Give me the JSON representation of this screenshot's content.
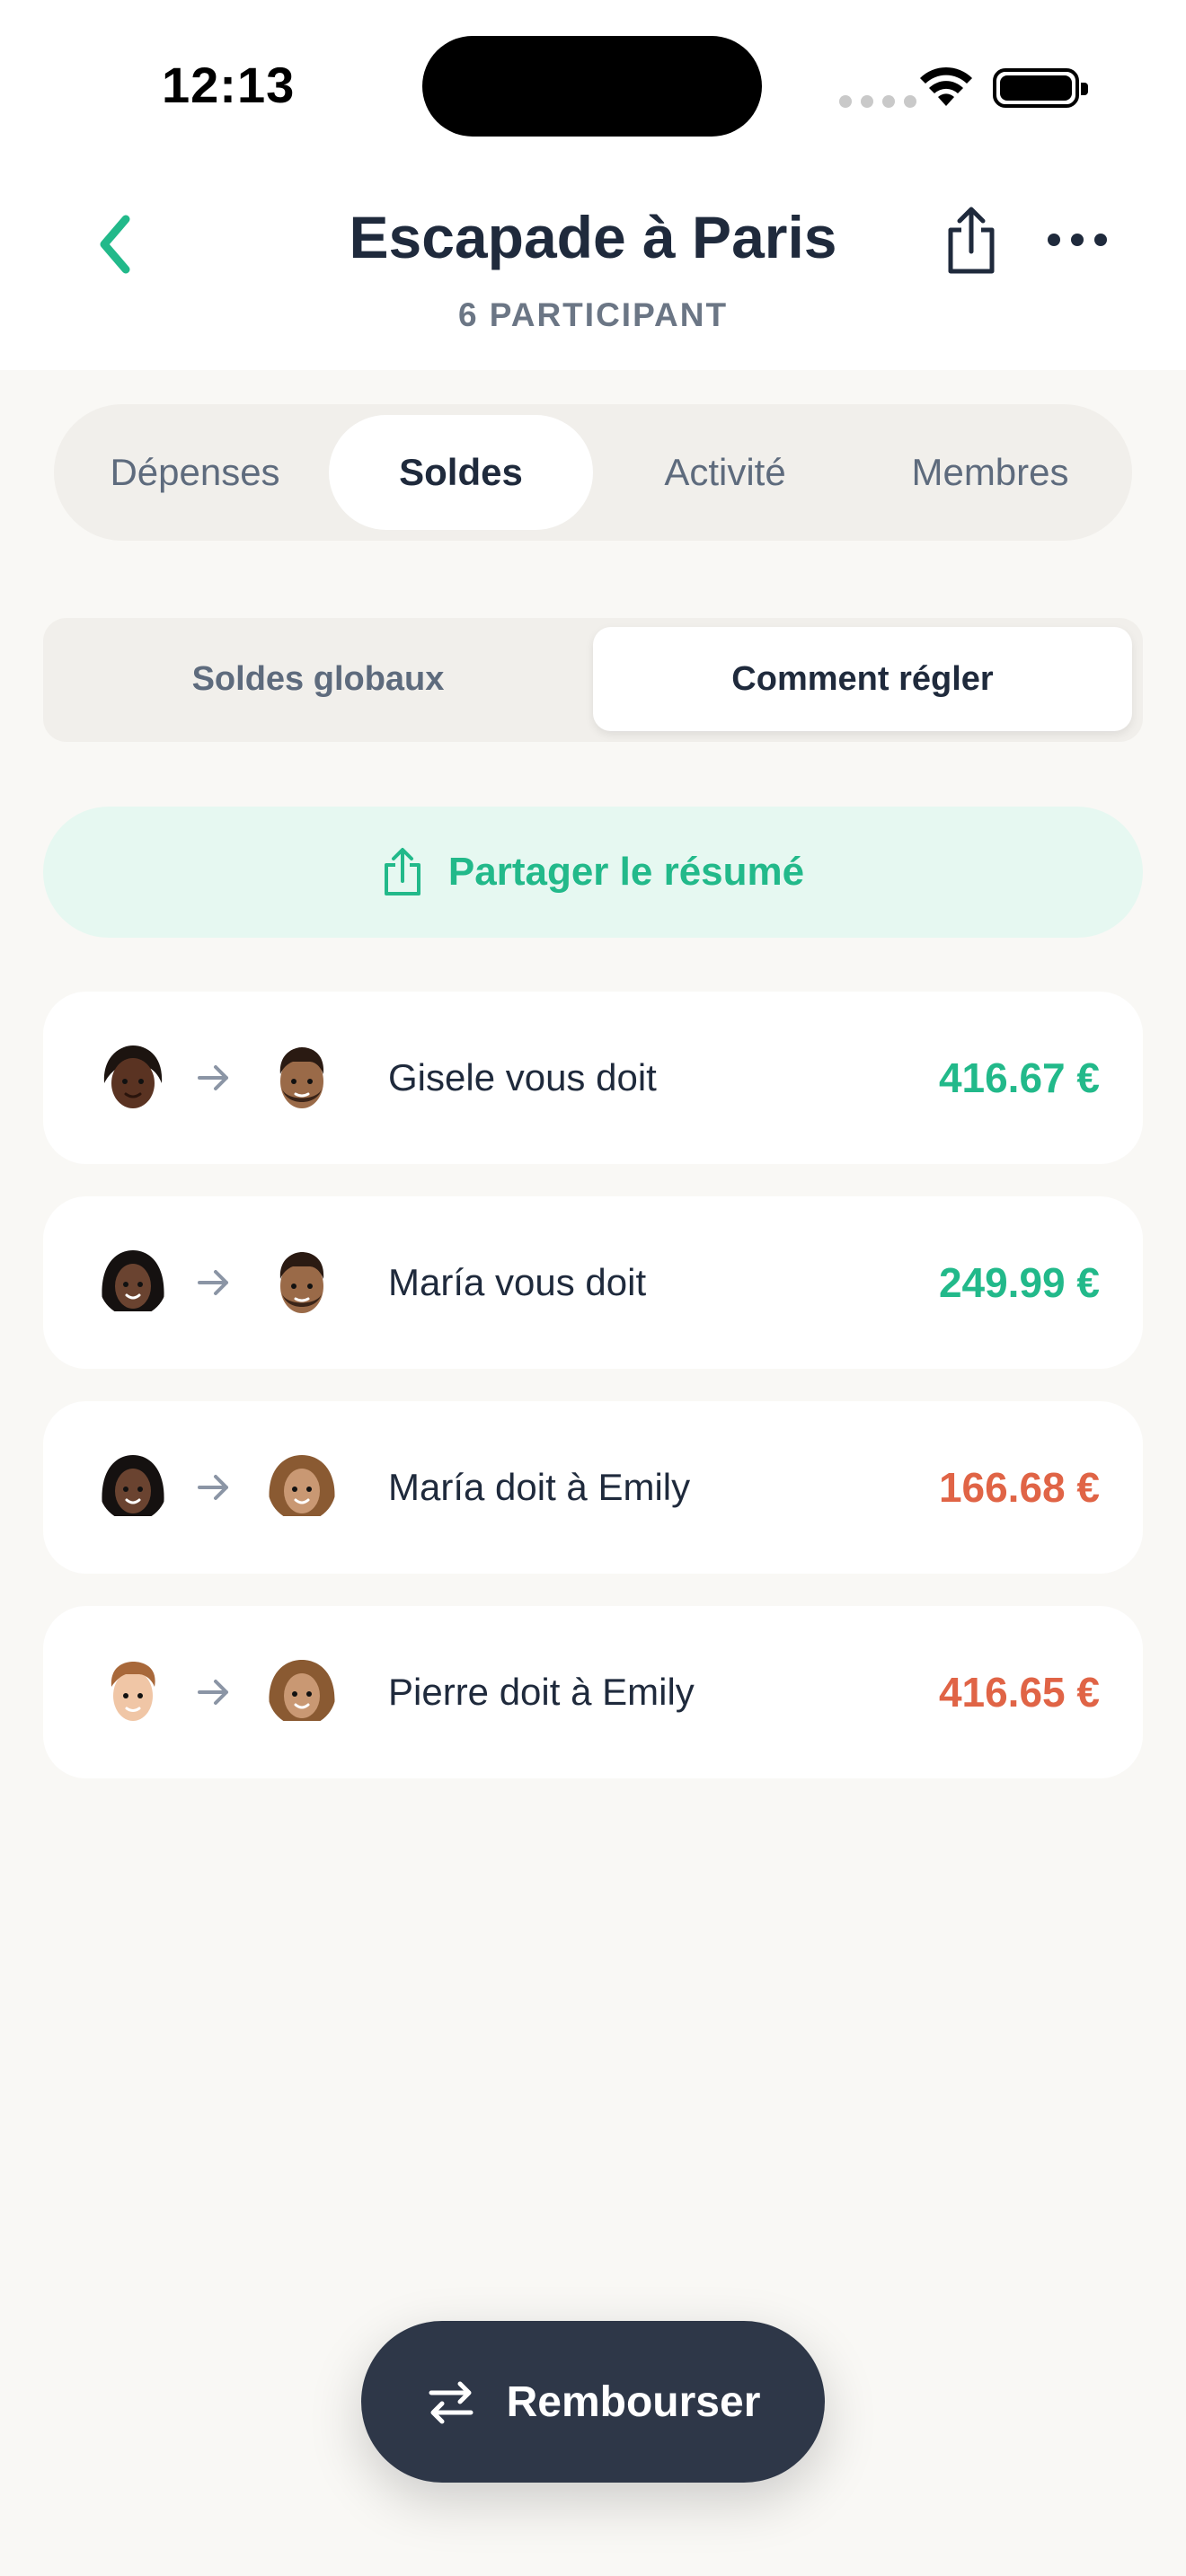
{
  "status_bar": {
    "time": "12:13"
  },
  "header": {
    "title": "Escapade à Paris",
    "subtitle": "6 PARTICIPANT"
  },
  "main_tabs": [
    {
      "label": "Dépenses",
      "active": false
    },
    {
      "label": "Soldes",
      "active": true
    },
    {
      "label": "Activité",
      "active": false
    },
    {
      "label": "Membres",
      "active": false
    }
  ],
  "balance_view": {
    "options": [
      {
        "label": "Soldes globaux",
        "active": false
      },
      {
        "label": "Comment régler",
        "active": true
      }
    ]
  },
  "share_summary": {
    "label": "Partager le résumé"
  },
  "settlements": [
    {
      "text": "Gisele vous doit",
      "amount": "416.67 €",
      "direction": "incoming",
      "from_avatar": "avatar-gisele",
      "to_avatar": "avatar-you"
    },
    {
      "text": "María vous doit",
      "amount": "249.99 €",
      "direction": "incoming",
      "from_avatar": "avatar-maria",
      "to_avatar": "avatar-you"
    },
    {
      "text": "María doit à Emily",
      "amount": "166.68 €",
      "direction": "outgoing",
      "from_avatar": "avatar-maria",
      "to_avatar": "avatar-emily"
    },
    {
      "text": "Pierre doit à Emily",
      "amount": "416.65 €",
      "direction": "outgoing",
      "from_avatar": "avatar-pierre",
      "to_avatar": "avatar-emily"
    }
  ],
  "reimburse_button": {
    "label": "Rembourser",
    "icon": "swap-arrows-icon"
  },
  "colors": {
    "accent": "#22b98a",
    "negative": "#e06446",
    "dark": "#2e3748",
    "background": "#f9f8f5"
  }
}
